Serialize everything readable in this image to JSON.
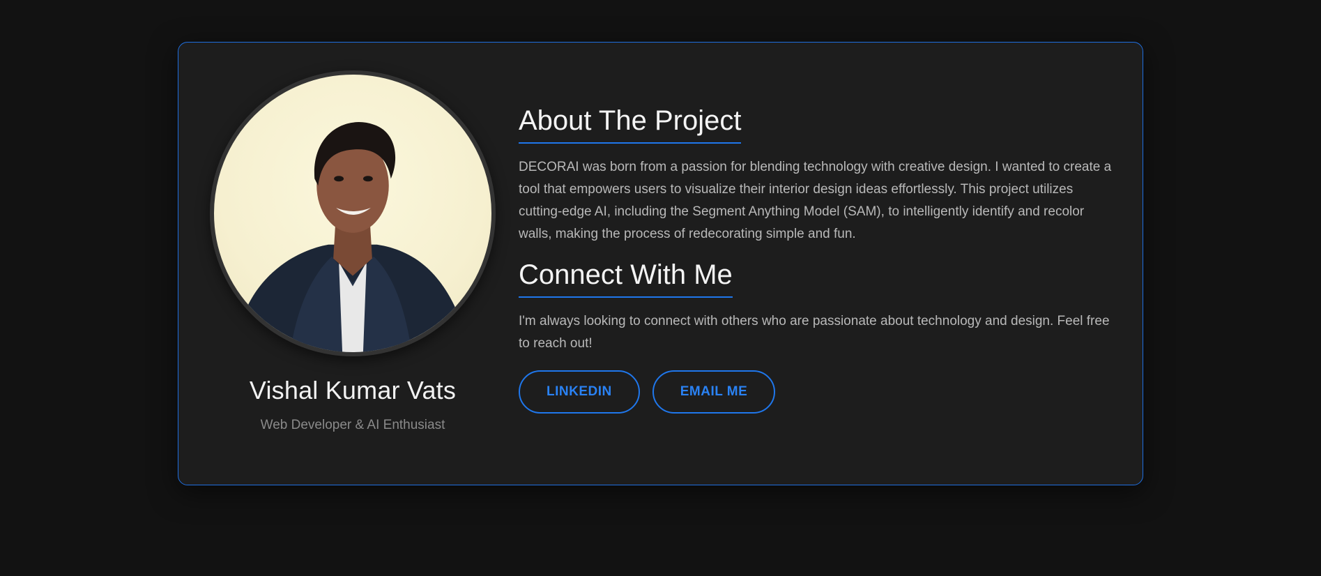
{
  "profile": {
    "name": "Vishal Kumar Vats",
    "role": "Web Developer & AI Enthusiast"
  },
  "about": {
    "heading": "About The Project",
    "text": "DECORAI was born from a passion for blending technology with creative design. I wanted to create a tool that empowers users to visualize their interior design ideas effortlessly. This project utilizes cutting-edge AI, including the Segment Anything Model (SAM), to intelligently identify and recolor walls, making the process of redecorating simple and fun."
  },
  "connect": {
    "heading": "Connect With Me",
    "text": "I'm always looking to connect with others who are passionate about technology and design. Feel free to reach out!",
    "buttons": {
      "linkedin": "LINKEDIN",
      "email": "EMAIL ME"
    }
  },
  "colors": {
    "accent": "#1f77ec",
    "background": "#121212",
    "card": "#1d1d1d"
  }
}
